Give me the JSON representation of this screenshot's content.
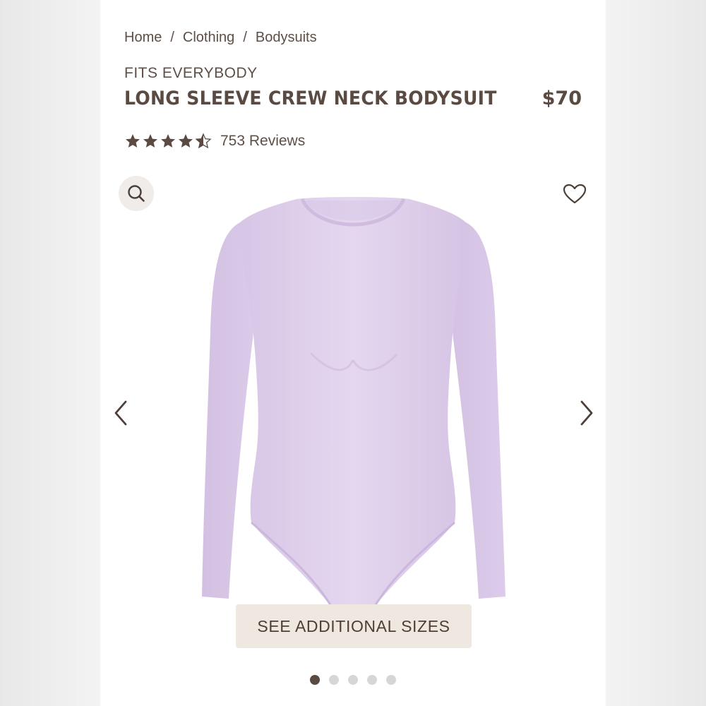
{
  "breadcrumb": {
    "items": [
      "Home",
      "Clothing",
      "Bodysuits"
    ],
    "separator": "/"
  },
  "product": {
    "brand_line": "FITS EVERYBODY",
    "title": "LONG SLEEVE CREW NECK BODYSUIT",
    "price": "$70",
    "rating_value": 4.5,
    "rating_max": 5,
    "reviews_label": "753 Reviews",
    "image_icon": "lavender-long-sleeve-bodysuit",
    "garment_color": "#e0d2ec"
  },
  "actions": {
    "zoom_icon": "search-icon",
    "favorite_icon": "heart-icon",
    "prev_icon": "chevron-left-icon",
    "next_icon": "chevron-right-icon",
    "sizes_button_label": "SEE ADDITIONAL SIZES"
  },
  "carousel": {
    "total": 5,
    "active_index": 0
  },
  "colors": {
    "text": "#5a4a42",
    "button_bg": "#efe8e0",
    "dot_active": "#5a4a42",
    "dot_inactive": "#d8d6d5"
  }
}
